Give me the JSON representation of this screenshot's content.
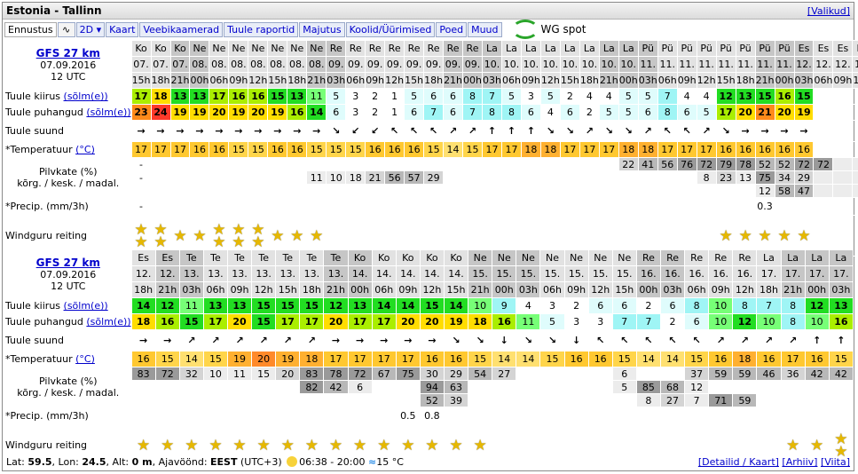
{
  "title": "Estonia - Tallinn",
  "valikud": "[Valikud]",
  "menu": [
    "Ennustus",
    "2D",
    "Kaart",
    "Veebikaamerad",
    "Tuule raportid",
    "Majutus",
    "Koolid/Üürimised",
    "Poed",
    "Muud"
  ],
  "wg_spot": "WG spot",
  "labels": {
    "speed": "Tuule kiirus",
    "gust": "Tuule puhangud",
    "unit": "(sõlm(e))",
    "dir": "Tuule suund",
    "temp": "*Temperatuur",
    "tunit": "(°C)",
    "cloud1": "Pilvkate (%)",
    "cloud2": "kõrg. / kesk. / madal.",
    "precip": "*Precip. (mm/3h)",
    "rating": "Windguru reiting"
  },
  "blocks": [
    {
      "model": "GFS 27 km",
      "date": "07.09.2016",
      "utc": "12 UTC",
      "days": [
        "Ko",
        "Ko",
        "Ko",
        "Ne",
        "Ne",
        "Ne",
        "Ne",
        "Ne",
        "Ne",
        "Ne",
        "Re",
        "Re",
        "Re",
        "Re",
        "Re",
        "Re",
        "Re",
        "Re",
        "La",
        "La",
        "La",
        "La",
        "La",
        "La",
        "La",
        "La",
        "Pü",
        "Pü",
        "Pü",
        "Pü",
        "Pü",
        "Pü",
        "Pü",
        "Pü",
        "Es",
        "Es",
        "Es",
        "Es",
        "Es"
      ],
      "dates": [
        "07.",
        "07.",
        "07.",
        "08.",
        "08.",
        "08.",
        "08.",
        "08.",
        "08.",
        "08.",
        "09.",
        "09.",
        "09.",
        "09.",
        "09.",
        "09.",
        "09.",
        "09.",
        "10.",
        "10.",
        "10.",
        "10.",
        "10.",
        "10.",
        "10.",
        "10.",
        "11.",
        "11.",
        "11.",
        "11.",
        "11.",
        "11.",
        "11.",
        "11.",
        "12.",
        "12.",
        "12.",
        "12.",
        "12."
      ],
      "hours": [
        "15h",
        "18h",
        "21h",
        "00h",
        "06h",
        "09h",
        "12h",
        "15h",
        "18h",
        "21h",
        "03h",
        "06h",
        "09h",
        "12h",
        "15h",
        "18h",
        "21h",
        "00h",
        "03h",
        "06h",
        "09h",
        "12h",
        "15h",
        "18h",
        "21h",
        "00h",
        "03h",
        "06h",
        "09h",
        "12h",
        "15h",
        "18h",
        "21h",
        "00h",
        "03h",
        "06h",
        "09h",
        "12h",
        "15h"
      ],
      "speed": [
        17,
        18,
        13,
        13,
        17,
        16,
        16,
        15,
        13,
        11,
        5,
        3,
        2,
        1,
        5,
        6,
        6,
        8,
        7,
        5,
        3,
        5,
        2,
        4,
        4,
        5,
        5,
        7,
        4,
        4,
        12,
        13,
        15,
        16,
        15
      ],
      "gust": [
        23,
        24,
        19,
        19,
        20,
        19,
        20,
        19,
        16,
        14,
        6,
        3,
        2,
        1,
        6,
        7,
        6,
        7,
        8,
        8,
        6,
        4,
        6,
        2,
        5,
        5,
        6,
        8,
        6,
        5,
        17,
        20,
        21,
        20,
        19
      ],
      "dir": [
        "→",
        "→",
        "→",
        "→",
        "→",
        "→",
        "→",
        "→",
        "→",
        "→",
        "↘",
        "↙",
        "↙",
        "↖",
        "↖",
        "↖",
        "↗",
        "↗",
        "↑",
        "↑",
        "↑",
        "↘",
        "↘",
        "↗",
        "↘",
        "↘",
        "↗",
        "↖",
        "↖",
        "↗",
        "↘",
        "→",
        "→",
        "→",
        "→"
      ],
      "temp": [
        17,
        17,
        17,
        16,
        16,
        15,
        15,
        16,
        16,
        15,
        15,
        15,
        16,
        16,
        16,
        15,
        14,
        15,
        17,
        17,
        18,
        18,
        17,
        17,
        17,
        18,
        18,
        17,
        17,
        17,
        16,
        16,
        16,
        16,
        16
      ],
      "cloud_h": [
        "-",
        "",
        "",
        "",
        "",
        "",
        "",
        "",
        "",
        "",
        "",
        "",
        "",
        "",
        "",
        "",
        "",
        "",
        "",
        "",
        "",
        "",
        "",
        "",
        "",
        "22",
        "41",
        "56",
        "76",
        "72",
        "79",
        "78",
        "52",
        "52",
        "72",
        "72"
      ],
      "cloud_m": [
        "-",
        "",
        "",
        "",
        "",
        "",
        "",
        "",
        "",
        "11",
        "10",
        "18",
        "21",
        "56",
        "57",
        "29",
        "",
        "",
        "",
        "",
        "",
        "",
        "",
        "",
        "",
        "",
        "",
        "",
        "",
        "8",
        "23",
        "13",
        "75",
        "34",
        "29"
      ],
      "cloud_l": [
        "",
        "",
        "",
        "",
        "",
        "",
        "",
        "",
        "",
        "",
        "",
        "",
        "",
        "",
        "",
        "",
        "",
        "",
        "",
        "",
        "",
        "",
        "",
        "",
        "",
        "",
        "",
        "",
        "",
        "",
        "",
        "",
        "12",
        "58",
        "47"
      ],
      "precip": [
        "-",
        "",
        "",
        "",
        "",
        "",
        "",
        "",
        "",
        "",
        "",
        "",
        "",
        "",
        "",
        "",
        "",
        "",
        "",
        "",
        "",
        "",
        "",
        "",
        "",
        "",
        "",
        "",
        "",
        "",
        "",
        "",
        "0.3",
        "",
        ""
      ],
      "rating": [
        2,
        2,
        1,
        1,
        2,
        2,
        2,
        1,
        1,
        1,
        0,
        0,
        0,
        0,
        0,
        0,
        0,
        0,
        0,
        0,
        0,
        0,
        0,
        0,
        0,
        0,
        0,
        0,
        0,
        0,
        1,
        1,
        1,
        1,
        1
      ]
    },
    {
      "model": "GFS 27 km",
      "date": "07.09.2016",
      "utc": "12 UTC",
      "days": [
        "Es",
        "Es",
        "Te",
        "Te",
        "Te",
        "Te",
        "Te",
        "Te",
        "Te",
        "Ko",
        "Ko",
        "Ko",
        "Ko",
        "Ko",
        "Ne",
        "Ne",
        "Ne",
        "Ne",
        "Ne",
        "Ne",
        "Ne",
        "Re",
        "Re",
        "Re",
        "Re",
        "Re",
        "La",
        "La",
        "La",
        "La"
      ],
      "dates": [
        "12.",
        "12.",
        "13.",
        "13.",
        "13.",
        "13.",
        "13.",
        "13.",
        "13.",
        "14.",
        "14.",
        "14.",
        "14.",
        "14.",
        "15.",
        "15.",
        "15.",
        "15.",
        "15.",
        "15.",
        "15.",
        "16.",
        "16.",
        "16.",
        "16.",
        "16.",
        "17.",
        "17.",
        "17.",
        "17."
      ],
      "hours": [
        "18h",
        "21h",
        "03h",
        "06h",
        "09h",
        "12h",
        "15h",
        "18h",
        "21h",
        "00h",
        "06h",
        "09h",
        "12h",
        "15h",
        "21h",
        "00h",
        "03h",
        "06h",
        "09h",
        "12h",
        "15h",
        "00h",
        "03h",
        "06h",
        "09h",
        "12h",
        "18h",
        "21h",
        "00h",
        "03h"
      ],
      "speed": [
        14,
        12,
        11,
        13,
        13,
        15,
        15,
        15,
        12,
        13,
        14,
        14,
        15,
        14,
        10,
        9,
        4,
        3,
        2,
        6,
        6,
        2,
        6,
        8,
        10,
        8,
        7,
        8,
        12,
        13
      ],
      "gust": [
        18,
        16,
        15,
        17,
        20,
        15,
        17,
        17,
        20,
        17,
        17,
        20,
        20,
        19,
        18,
        16,
        11,
        5,
        3,
        3,
        7,
        7,
        2,
        6,
        10,
        12,
        10,
        8,
        10,
        16
      ],
      "dir": [
        "→",
        "→",
        "↗",
        "↗",
        "↗",
        "↗",
        "↗",
        "↗",
        "→",
        "→",
        "→",
        "→",
        "→",
        "↘",
        "↘",
        "↓",
        "↘",
        "↘",
        "↓",
        "↖",
        "↖",
        "↖",
        "↖",
        "↖",
        "↗",
        "↗",
        "↗",
        "↗",
        "↑",
        "↑"
      ],
      "temp": [
        16,
        15,
        14,
        15,
        19,
        20,
        19,
        18,
        17,
        17,
        17,
        17,
        16,
        16,
        15,
        14,
        14,
        15,
        16,
        16,
        15,
        14,
        14,
        15,
        16,
        18,
        16,
        17,
        16,
        15
      ],
      "cloud_h": [
        "83",
        "72",
        "32",
        "10",
        "11",
        "15",
        "20",
        "83",
        "78",
        "72",
        "67",
        "75",
        "30",
        "29",
        "54",
        "27",
        "",
        "",
        "",
        "",
        "6",
        "",
        "",
        "37",
        "59",
        "59",
        "46",
        "36",
        "42",
        "42"
      ],
      "cloud_m": [
        "",
        "",
        "",
        "",
        "",
        "",
        "",
        "82",
        "42",
        "6",
        "",
        "",
        "94",
        "63",
        "",
        "",
        "",
        "",
        "",
        "",
        "5",
        "85",
        "68",
        "12",
        "",
        "",
        "",
        "",
        "",
        ""
      ],
      "cloud_l": [
        "",
        "",
        "",
        "",
        "",
        "",
        "",
        "",
        "",
        "",
        "",
        "",
        "52",
        "39",
        "",
        "",
        "",
        "",
        "",
        "",
        "",
        "8",
        "27",
        "7",
        "71",
        "59",
        "",
        "",
        "",
        ""
      ],
      "precip": [
        "",
        "",
        "",
        "",
        "",
        "",
        "",
        "",
        "",
        "",
        "",
        "0.5",
        "0.8",
        "",
        "",
        "",
        "",
        "",
        "",
        "",
        "",
        "",
        "",
        "",
        "",
        "",
        "",
        "",
        "",
        ""
      ],
      "rating": [
        1,
        1,
        1,
        1,
        1,
        1,
        1,
        1,
        1,
        1,
        1,
        1,
        1,
        1,
        1,
        0,
        0,
        0,
        0,
        0,
        0,
        0,
        0,
        0,
        0,
        0,
        0,
        1,
        1,
        2
      ]
    }
  ],
  "footer": {
    "lat_label": "Lat:",
    "lat": "59.5",
    "lon_label": "Lon:",
    "lon": "24.5",
    "alt_label": "Alt:",
    "alt": "0 m",
    "tz_label": "Ajavöönd:",
    "tz": "EEST",
    "tz_off": "(UTC+3)",
    "sun": "06:38 - 20:00",
    "water": "15 °C"
  },
  "footer_links": [
    "[Detailid / Kaart]",
    "[Arhiiv]",
    "[Viita]"
  ],
  "colors": {
    "green": "#22dd22",
    "lime": "#88ee00",
    "yellow": "#ffff00",
    "orange": "#ffbb00",
    "red": "#ff4433",
    "cyan": "#aaffff",
    "temp_yellow": "#ffc000"
  }
}
